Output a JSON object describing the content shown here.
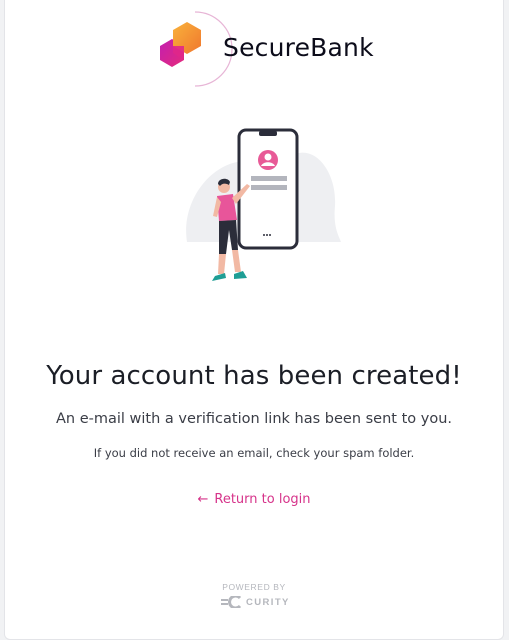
{
  "brand": {
    "name": "SecureBank",
    "colors": {
      "accent": "#d6338a",
      "logo_orange": "#f7a33a",
      "logo_pink": "#e0278a",
      "logo_purple": "#b11fb4"
    }
  },
  "illustration": {
    "icon": "phone-profile-illustration"
  },
  "content": {
    "title": "Your account has been created!",
    "subtitle": "An e-mail with a verification link has been sent to you.",
    "hint": "If you did not receive an email, check your spam folder.",
    "return_link": {
      "icon": "arrow-left-icon",
      "arrow": "←",
      "label": "Return to login"
    }
  },
  "footer": {
    "powered_by": "POWERED BY",
    "vendor": "CURITY"
  }
}
